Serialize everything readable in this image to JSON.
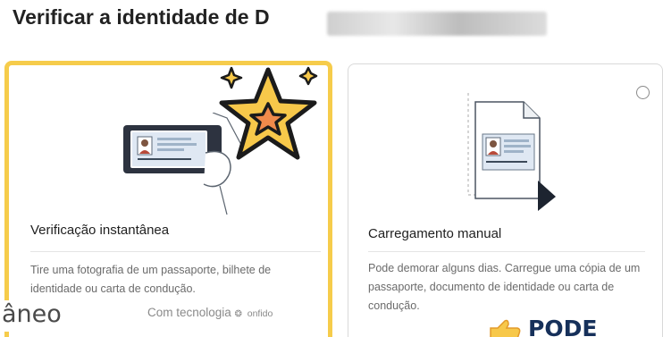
{
  "page": {
    "title": "Verificar a identidade de D"
  },
  "options": [
    {
      "id": "instant",
      "title": "Verificação instantânea",
      "description": "Tire uma fotografia de um passaporte, bilhete de identidade ou carta de condução.",
      "powered_label": "Com tecnologia",
      "powered_brand": "onfido",
      "selected": true,
      "icon": "phone-id-scan-icon"
    },
    {
      "id": "manual",
      "title": "Carregamento manual",
      "description": "Pode demorar alguns dias. Carregue uma cópia de um passaporte, documento de identidade ou carta de condução.",
      "selected": false,
      "icon": "document-upload-icon"
    }
  ],
  "overlay": {
    "caption_fragment": "âneo",
    "sticker_label": "PODE",
    "star_sticker": "star-icon",
    "thumb_sticker": "thumbs-up-icon"
  },
  "colors": {
    "selected_border": "#f6cc4b",
    "card_border": "#d9d9d9",
    "title_text": "#222222",
    "desc_text": "#6b6b6b",
    "sticker_text": "#16305a",
    "star_fill": "#f7c84a",
    "star_inner": "#f08a4b"
  }
}
